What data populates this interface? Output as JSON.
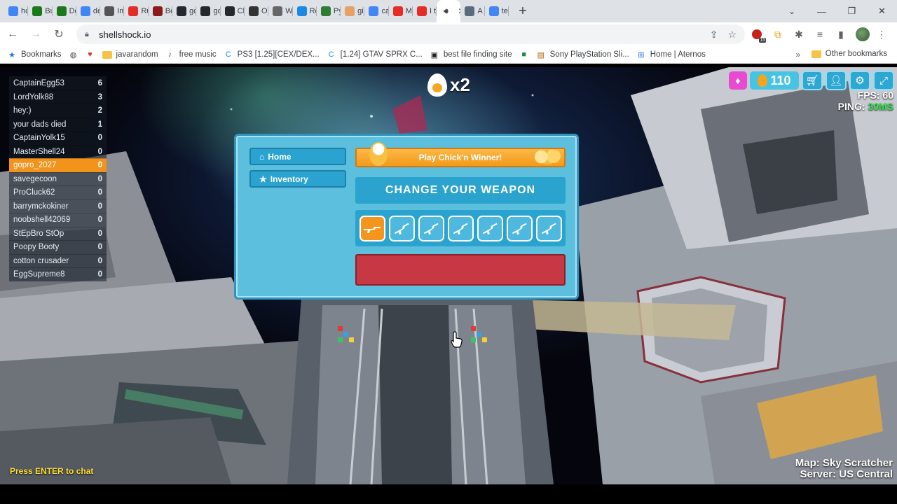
{
  "browser": {
    "tabs": [
      {
        "label": "hc",
        "icon": "google-g-icon",
        "color": "#4285f4"
      },
      {
        "label": "Bu",
        "icon": "terminal-icon",
        "color": "#1a7a1a"
      },
      {
        "label": "Dc",
        "icon": "terminal-icon",
        "color": "#1a7a1a"
      },
      {
        "label": "de",
        "icon": "google-g-icon",
        "color": "#4285f4"
      },
      {
        "label": "Im",
        "icon": "chart-icon",
        "color": "#555555"
      },
      {
        "label": "Ru",
        "icon": "youtube-icon",
        "color": "#e52d27"
      },
      {
        "label": "Be",
        "icon": "m-icon",
        "color": "#8b1a1a"
      },
      {
        "label": "gc",
        "icon": "github-icon",
        "color": "#24292f"
      },
      {
        "label": "gc",
        "icon": "github-icon",
        "color": "#24292f"
      },
      {
        "label": "Cl",
        "icon": "github-icon",
        "color": "#24292f"
      },
      {
        "label": "O;",
        "icon": "openai-icon",
        "color": "#333333"
      },
      {
        "label": "W",
        "icon": "globe-icon",
        "color": "#666666"
      },
      {
        "label": "Re",
        "icon": "dot-icon",
        "color": "#1e88e5"
      },
      {
        "label": "Py",
        "icon": "w-icon",
        "color": "#2e7d32"
      },
      {
        "label": "gi",
        "icon": "hand-icon",
        "color": "#e8a064"
      },
      {
        "label": "ca",
        "icon": "google-g-icon",
        "color": "#4285f4"
      },
      {
        "label": "M",
        "icon": "youtube-icon",
        "color": "#e52d27"
      },
      {
        "label": "I t",
        "icon": "youtube-icon",
        "color": "#e52d27"
      },
      {
        "label": "",
        "icon": "speaker-icon",
        "color": "#3c4043",
        "active": true
      },
      {
        "label": "A",
        "icon": "image-icon",
        "color": "#5a6b7c"
      },
      {
        "label": "te",
        "icon": "google-g-icon",
        "color": "#4285f4"
      }
    ],
    "new_tab": "+",
    "url": "shellshock.io",
    "extension_badge": "15",
    "bookmarks": [
      {
        "label": "Bookmarks",
        "icon": "star-icon"
      },
      {
        "label": "",
        "icon": "globe-icon"
      },
      {
        "label": "",
        "icon": "heart-icon"
      },
      {
        "label": "javarandom",
        "icon": "folder-icon"
      },
      {
        "label": "free music",
        "icon": "music-icon"
      },
      {
        "label": "PS3 [1.25][CEX/DEX...",
        "icon": "c-icon"
      },
      {
        "label": "[1.24] GTAV SPRX C...",
        "icon": "c-icon"
      },
      {
        "label": "best file finding site",
        "icon": "bag-icon"
      },
      {
        "label": "",
        "icon": "app-icon"
      },
      {
        "label": "Sony PlayStation Sli...",
        "icon": "gift-icon"
      },
      {
        "label": "Home | Aternos",
        "icon": "aternos-icon"
      }
    ],
    "other_bookmarks": "Other bookmarks"
  },
  "scoreboard": [
    {
      "name": "CaptainEgg53",
      "score": "6"
    },
    {
      "name": "LordYolk88",
      "score": "3"
    },
    {
      "name": "hey:)",
      "score": "2"
    },
    {
      "name": "your dads died",
      "score": "1"
    },
    {
      "name": "CaptainYolk15",
      "score": "0"
    },
    {
      "name": "MasterShell24",
      "score": "0"
    },
    {
      "name": "gopro_2027",
      "score": "0",
      "me": true
    },
    {
      "name": "savegecoon",
      "score": "0"
    },
    {
      "name": "ProCluck62",
      "score": "0"
    },
    {
      "name": "barrymckokiner",
      "score": "0"
    },
    {
      "name": "noobshell42069",
      "score": "0"
    },
    {
      "name": "StEpBro StOp",
      "score": "0"
    },
    {
      "name": "Poopy Booty",
      "score": "0"
    },
    {
      "name": "cotton crusader",
      "score": "0"
    },
    {
      "name": "EggSupreme8",
      "score": "0"
    }
  ],
  "hud": {
    "kill_multiplier": "x2",
    "eggs": "110",
    "fps_label": "FPS: 60",
    "ping_label": "PING:",
    "ping_value": "30MS",
    "chat_hint": "Press ENTER to chat",
    "map_label": "Map: Sky Scratcher",
    "server_label": "Server: US Central"
  },
  "menu": {
    "home_label": "Home",
    "inventory_label": "Inventory",
    "chickn_label": "Play Chick'n Winner!",
    "weapon_title": "CHANGE YOUR WEAPON",
    "weapons": [
      "eggk-47",
      "scrambler",
      "free-ranger",
      "rpegg",
      "whipper",
      "crackshot",
      "tri-hard"
    ],
    "selected_weapon": 0,
    "play_button_label": ""
  },
  "colors": {
    "panel": "#5cbfdd",
    "accent_orange": "#f4961e",
    "play_red": "#c73744",
    "ping_green": "#2ee84a",
    "chat_yellow": "#ffe135"
  }
}
